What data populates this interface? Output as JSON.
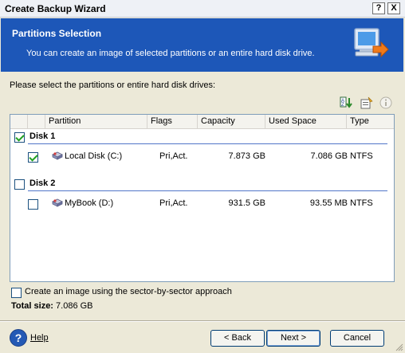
{
  "window": {
    "title": "Create Backup Wizard"
  },
  "titlebar_buttons": {
    "help": "?",
    "close": "X"
  },
  "header": {
    "title": "Partitions Selection",
    "subtitle": "You can create an image of selected partitions or an entire hard disk drive."
  },
  "prompt": "Please select the partitions or entire hard disk drives:",
  "toolbar_icons": [
    "sort-icon",
    "properties-icon",
    "info-icon"
  ],
  "columns": {
    "partition": "Partition",
    "flags": "Flags",
    "capacity": "Capacity",
    "used_space": "Used Space",
    "type": "Type"
  },
  "disks": [
    {
      "label": "Disk 1",
      "checked": true,
      "partition": {
        "name": "Local Disk (C:)",
        "flags": "Pri,Act.",
        "capacity": "7.873 GB",
        "used": "7.086 GB",
        "type": "NTFS",
        "checked": true
      }
    },
    {
      "label": "Disk 2",
      "checked": false,
      "partition": {
        "name": "MyBook (D:)",
        "flags": "Pri,Act.",
        "capacity": "931.5 GB",
        "used": "93.55 MB",
        "type": "NTFS",
        "checked": false
      }
    }
  ],
  "sector_option": {
    "label": "Create an image using the sector-by-sector approach",
    "checked": false
  },
  "total": {
    "label": "Total size:",
    "value": "7.086 GB"
  },
  "footer": {
    "help": "Help",
    "back": "< Back",
    "next": "Next >",
    "cancel": "Cancel"
  }
}
